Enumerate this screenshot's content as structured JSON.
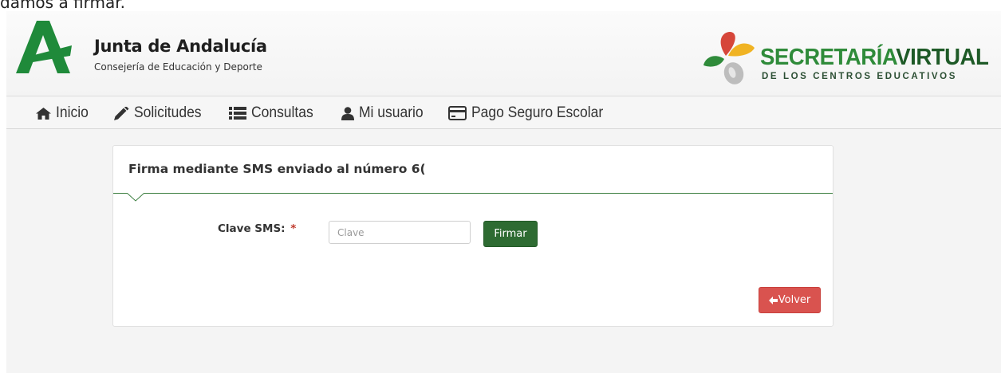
{
  "caption": {
    "text": "damos a firmar."
  },
  "header": {
    "org_title": "Junta de Andalucía",
    "org_subtitle": "Consejería de Educación y Deporte",
    "brand_secretaria": "SECRETARÍA",
    "brand_virtual": "VIRTUAL",
    "brand_subtitle": "DE LOS CENTROS EDUCATIVOS"
  },
  "nav": {
    "items": [
      {
        "label": "Inicio",
        "icon": "home-icon"
      },
      {
        "label": "Solicitudes",
        "icon": "pencil-icon"
      },
      {
        "label": "Consultas",
        "icon": "list-icon"
      },
      {
        "label": "Mi usuario",
        "icon": "user-icon"
      },
      {
        "label": "Pago Seguro Escolar",
        "icon": "credit-card-icon"
      }
    ]
  },
  "panel": {
    "title": "Firma mediante SMS enviado al número 6(",
    "field_label": "Clave SMS:",
    "required_mark": "*",
    "input_placeholder": "Clave",
    "input_value": "",
    "sign_button": "Firmar",
    "back_button": "Volver"
  },
  "colors": {
    "brand_green": "#2e6b32",
    "danger_red": "#d9534f",
    "divider_green": "#3a7d3e"
  }
}
